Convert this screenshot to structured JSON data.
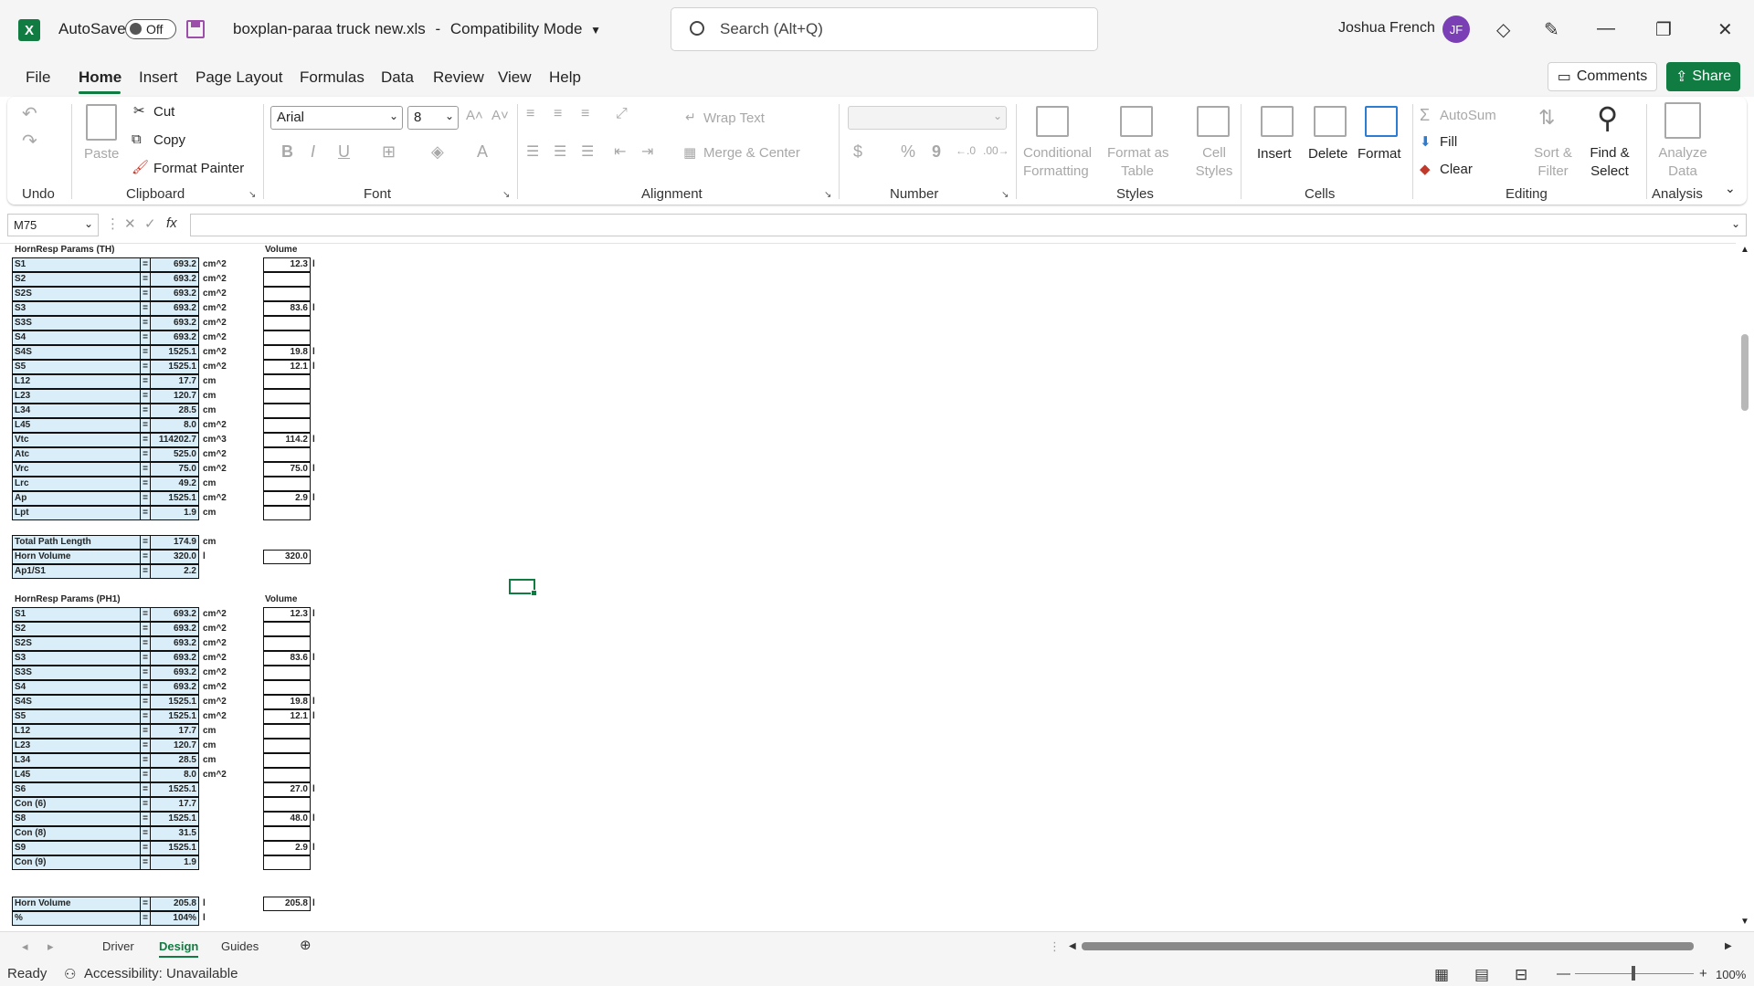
{
  "title": {
    "app_icon": "X",
    "autosave_label": "AutoSave",
    "autosave_state": "Off",
    "filename": "boxplan-paraa truck new.xls",
    "separator": "-",
    "mode": "Compatibility Mode",
    "search_placeholder": "Search (Alt+Q)",
    "user_name": "Joshua French",
    "user_initials": "JF"
  },
  "menu": {
    "items": [
      "File",
      "Home",
      "Insert",
      "Page Layout",
      "Formulas",
      "Data",
      "Review",
      "View",
      "Help"
    ],
    "comments_label": "Comments",
    "share_label": "Share"
  },
  "ribbon": {
    "groups": {
      "undo": "Undo",
      "clipboard": "Clipboard",
      "font": "Font",
      "alignment": "Alignment",
      "number": "Number",
      "styles": "Styles",
      "cells": "Cells",
      "editing": "Editing",
      "analysis": "Analysis"
    },
    "paste": "Paste",
    "cut": "Cut",
    "copy": "Copy",
    "format_painter": "Format Painter",
    "font_name": "Arial",
    "font_size": "8",
    "wrap_text": "Wrap Text",
    "merge_center": "Merge & Center",
    "conditional": [
      "Conditional",
      "Formatting"
    ],
    "format_table": [
      "Format as",
      "Table"
    ],
    "cell_styles": [
      "Cell",
      "Styles"
    ],
    "insert": "Insert",
    "delete": "Delete",
    "format": "Format",
    "autosum": "AutoSum",
    "fill": "Fill",
    "clear": "Clear",
    "sort_filter": [
      "Sort &",
      "Filter"
    ],
    "find_select": [
      "Find &",
      "Select"
    ],
    "analyze": [
      "Analyze",
      "Data"
    ],
    "bold": "B",
    "italic": "I",
    "underline": "U",
    "currency": "$",
    "percent": "%",
    "comma": "9"
  },
  "formula_bar": {
    "name_box": "M75",
    "fx": "fx",
    "value": ""
  },
  "sheet": {
    "table1_title": "HornResp Params (TH)",
    "table2_title": "HornResp Params (PH1)",
    "volume_header": "Volume",
    "table1": [
      {
        "label": "S1",
        "eq": "=",
        "value": "693.2",
        "unit": "cm^2",
        "vol": "12.3",
        "l": "l"
      },
      {
        "label": "S2",
        "eq": "=",
        "value": "693.2",
        "unit": "cm^2",
        "vol": "",
        "l": ""
      },
      {
        "label": "S2S",
        "eq": "=",
        "value": "693.2",
        "unit": "cm^2",
        "vol": "",
        "l": ""
      },
      {
        "label": "S3",
        "eq": "=",
        "value": "693.2",
        "unit": "cm^2",
        "vol": "83.6",
        "l": "l"
      },
      {
        "label": "S3S",
        "eq": "=",
        "value": "693.2",
        "unit": "cm^2",
        "vol": "",
        "l": ""
      },
      {
        "label": "S4",
        "eq": "=",
        "value": "693.2",
        "unit": "cm^2",
        "vol": "",
        "l": ""
      },
      {
        "label": "S4S",
        "eq": "=",
        "value": "1525.1",
        "unit": "cm^2",
        "vol": "19.8",
        "l": "l"
      },
      {
        "label": "S5",
        "eq": "=",
        "value": "1525.1",
        "unit": "cm^2",
        "vol": "12.1",
        "l": "l"
      },
      {
        "label": "L12",
        "eq": "=",
        "value": "17.7",
        "unit": "cm",
        "vol": "",
        "l": ""
      },
      {
        "label": "L23",
        "eq": "=",
        "value": "120.7",
        "unit": "cm",
        "vol": "",
        "l": ""
      },
      {
        "label": "L34",
        "eq": "=",
        "value": "28.5",
        "unit": "cm",
        "vol": "",
        "l": ""
      },
      {
        "label": "L45",
        "eq": "=",
        "value": "8.0",
        "unit": "cm^2",
        "vol": "",
        "l": ""
      },
      {
        "label": "Vtc",
        "eq": "=",
        "value": "114202.7",
        "unit": "cm^3",
        "vol": "114.2",
        "l": "l"
      },
      {
        "label": "Atc",
        "eq": "=",
        "value": "525.0",
        "unit": "cm^2",
        "vol": "",
        "l": ""
      },
      {
        "label": "Vrc",
        "eq": "=",
        "value": "75.0",
        "unit": "cm^2",
        "vol": "75.0",
        "l": "l"
      },
      {
        "label": "Lrc",
        "eq": "=",
        "value": "49.2",
        "unit": "cm",
        "vol": "",
        "l": ""
      },
      {
        "label": "Ap",
        "eq": "=",
        "value": "1525.1",
        "unit": "cm^2",
        "vol": "2.9",
        "l": "l"
      },
      {
        "label": "Lpt",
        "eq": "=",
        "value": "1.9",
        "unit": "cm",
        "vol": "",
        "l": ""
      }
    ],
    "summary1": [
      {
        "label": "Total Path Length",
        "eq": "=",
        "value": "174.9",
        "unit": "cm",
        "vol": null,
        "l": ""
      },
      {
        "label": "Horn Volume",
        "eq": "=",
        "value": "320.0",
        "unit": "l",
        "vol": "320.0",
        "l": ""
      },
      {
        "label": "Ap1/S1",
        "eq": "=",
        "value": "2.2",
        "unit": "",
        "vol": null,
        "l": ""
      }
    ],
    "table2": [
      {
        "label": "S1",
        "eq": "=",
        "value": "693.2",
        "unit": "cm^2",
        "vol": "12.3",
        "l": "l"
      },
      {
        "label": "S2",
        "eq": "=",
        "value": "693.2",
        "unit": "cm^2",
        "vol": "",
        "l": ""
      },
      {
        "label": "S2S",
        "eq": "=",
        "value": "693.2",
        "unit": "cm^2",
        "vol": "",
        "l": ""
      },
      {
        "label": "S3",
        "eq": "=",
        "value": "693.2",
        "unit": "cm^2",
        "vol": "83.6",
        "l": "l"
      },
      {
        "label": "S3S",
        "eq": "=",
        "value": "693.2",
        "unit": "cm^2",
        "vol": "",
        "l": ""
      },
      {
        "label": "S4",
        "eq": "=",
        "value": "693.2",
        "unit": "cm^2",
        "vol": "",
        "l": ""
      },
      {
        "label": "S4S",
        "eq": "=",
        "value": "1525.1",
        "unit": "cm^2",
        "vol": "19.8",
        "l": "l"
      },
      {
        "label": "S5",
        "eq": "=",
        "value": "1525.1",
        "unit": "cm^2",
        "vol": "12.1",
        "l": "l"
      },
      {
        "label": "L12",
        "eq": "=",
        "value": "17.7",
        "unit": "cm",
        "vol": "",
        "l": ""
      },
      {
        "label": "L23",
        "eq": "=",
        "value": "120.7",
        "unit": "cm",
        "vol": "",
        "l": ""
      },
      {
        "label": "L34",
        "eq": "=",
        "value": "28.5",
        "unit": "cm",
        "vol": "",
        "l": ""
      },
      {
        "label": "L45",
        "eq": "=",
        "value": "8.0",
        "unit": "cm^2",
        "vol": "",
        "l": ""
      },
      {
        "label": "S6",
        "eq": "=",
        "value": "1525.1",
        "unit": "",
        "vol": "27.0",
        "l": "l"
      },
      {
        "label": "Con (6)",
        "eq": "=",
        "value": "17.7",
        "unit": "",
        "vol": "",
        "l": ""
      },
      {
        "label": "S8",
        "eq": "=",
        "value": "1525.1",
        "unit": "",
        "vol": "48.0",
        "l": "l"
      },
      {
        "label": "Con (8)",
        "eq": "=",
        "value": "31.5",
        "unit": "",
        "vol": "",
        "l": ""
      },
      {
        "label": "S9",
        "eq": "=",
        "value": "1525.1",
        "unit": "",
        "vol": "2.9",
        "l": "l"
      },
      {
        "label": "Con (9)",
        "eq": "=",
        "value": "1.9",
        "unit": "",
        "vol": "",
        "l": ""
      }
    ],
    "summary2": [
      {
        "label": "Horn Volume",
        "eq": "=",
        "value": "205.8",
        "unit": "l",
        "vol": "205.8",
        "l": "l"
      },
      {
        "label": "%",
        "eq": "=",
        "value": "104%",
        "unit": "l",
        "vol": null,
        "l": ""
      }
    ]
  },
  "tabs": {
    "items": [
      "Driver",
      "Design",
      "Guides"
    ],
    "active": "Design"
  },
  "status": {
    "ready": "Ready",
    "accessibility": "Accessibility: Unavailable",
    "zoom": "100%"
  },
  "colors": {
    "accent": "#107c41",
    "cell_fill": "#d9eef8",
    "avatar": "#7a3fb5"
  }
}
